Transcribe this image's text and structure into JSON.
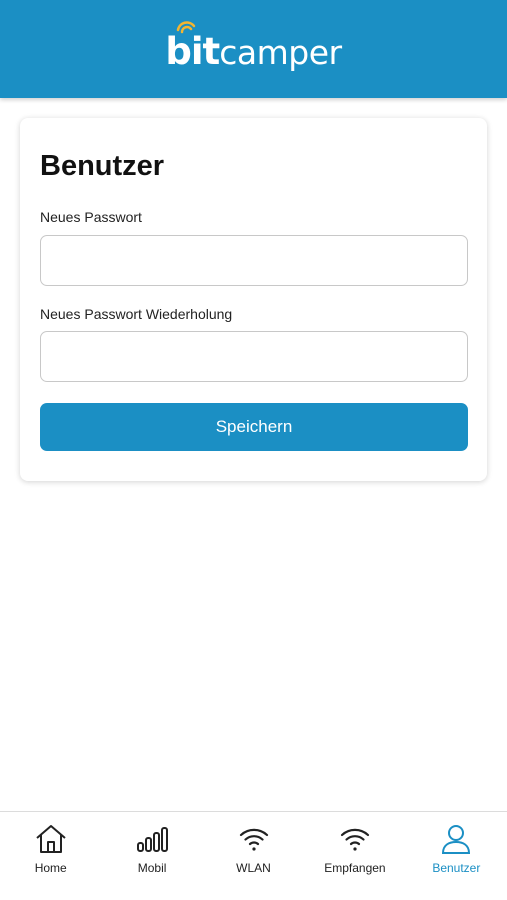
{
  "header": {
    "logo_bold": "bit",
    "logo_light": "camper",
    "brand_color": "#1b8fc4",
    "logo_icon": "wifi-wave-icon"
  },
  "card": {
    "title": "Benutzer",
    "new_password_label": "Neues Passwort",
    "new_password_value": "",
    "repeat_password_label": "Neues Passwort Wiederholung",
    "repeat_password_value": "",
    "save_label": "Speichern"
  },
  "nav": {
    "active_color": "#1b8fc4",
    "items": [
      {
        "label": "Home",
        "icon": "home-icon",
        "active": false
      },
      {
        "label": "Mobil",
        "icon": "signal-bars-icon",
        "active": false
      },
      {
        "label": "WLAN",
        "icon": "wifi-icon",
        "active": false
      },
      {
        "label": "Empfangen",
        "icon": "wifi-receive-icon",
        "active": false
      },
      {
        "label": "Benutzer",
        "icon": "user-icon",
        "active": true
      }
    ]
  }
}
